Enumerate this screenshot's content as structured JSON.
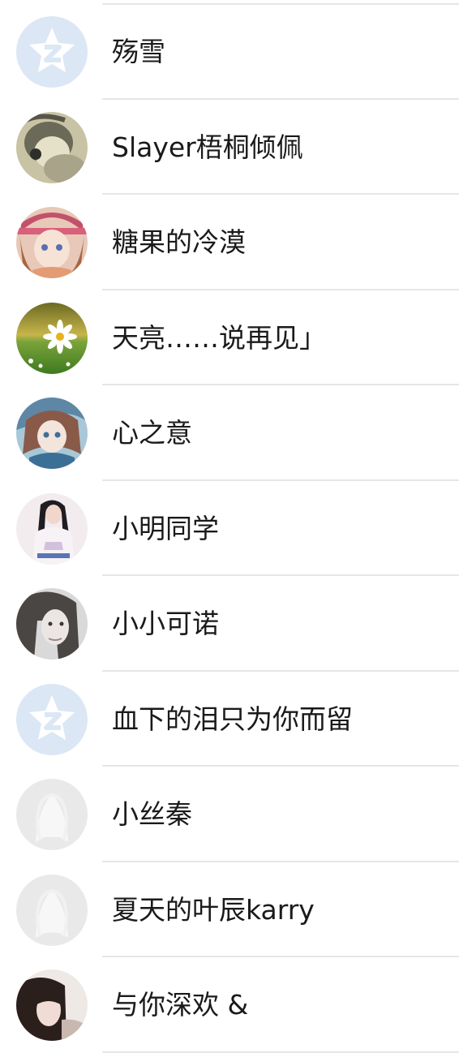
{
  "contacts": [
    {
      "name": "殇雪",
      "avatar": "default-qq-star-icon"
    },
    {
      "name": "Slayer梧桐倾佩",
      "avatar": "anime-hooded-character-photo"
    },
    {
      "name": "糖果的冷漠",
      "avatar": "anime-girl-cap-photo"
    },
    {
      "name": "天亮……说再见」",
      "avatar": "daisy-flower-photo"
    },
    {
      "name": "心之意",
      "avatar": "anime-girl-blue-photo"
    },
    {
      "name": "小明同学",
      "avatar": "girl-portrait-photo"
    },
    {
      "name": "小小可诺",
      "avatar": "girl-bw-portrait-photo"
    },
    {
      "name": "血下的泪只为你而留",
      "avatar": "default-qq-star-icon"
    },
    {
      "name": "小丝秦",
      "avatar": "default-person-silhouette-icon"
    },
    {
      "name": "夏天的叶辰karry",
      "avatar": "default-person-silhouette-icon"
    },
    {
      "name": "与你深欢 &",
      "avatar": "girl-dark-hair-photo"
    }
  ],
  "colors": {
    "divider": "#e6e6e6",
    "name_text": "#1a1a1a",
    "qq_default_bg": "#dbe7f4",
    "silhouette_bg": "#e9e9e9"
  }
}
